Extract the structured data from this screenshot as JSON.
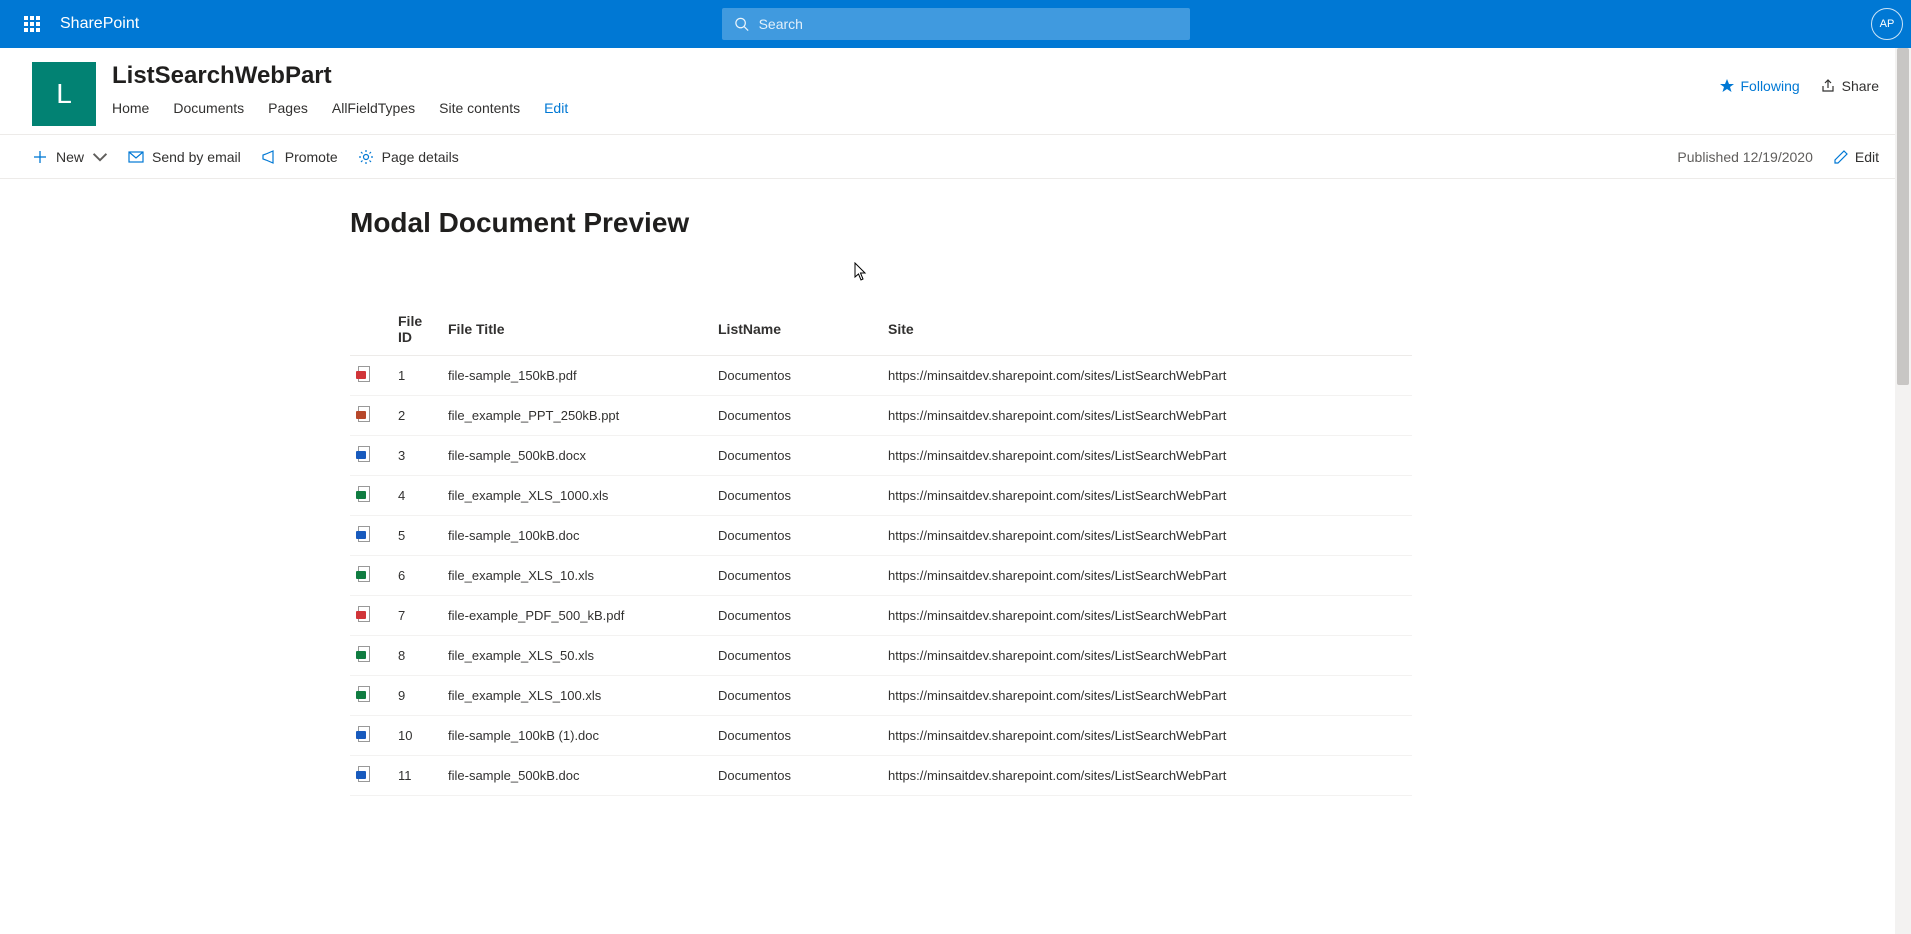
{
  "suite": {
    "brand": "SharePoint",
    "search_placeholder": "Search",
    "avatar_initials": "AP"
  },
  "site": {
    "logo_letter": "L",
    "title": "ListSearchWebPart",
    "nav": {
      "home": "Home",
      "documents": "Documents",
      "pages": "Pages",
      "allfieldtypes": "AllFieldTypes",
      "site_contents": "Site contents",
      "edit": "Edit"
    },
    "follow_label": "Following",
    "share_label": "Share"
  },
  "commandbar": {
    "new": "New",
    "send_by_email": "Send by email",
    "promote": "Promote",
    "page_details": "Page details",
    "published": "Published 12/19/2020",
    "edit": "Edit"
  },
  "page": {
    "title": "Modal Document Preview"
  },
  "table": {
    "headers": {
      "icon": "",
      "file_id": "File ID",
      "file_title": "File Title",
      "list_name": "ListName",
      "site": "Site"
    },
    "rows": [
      {
        "icon": "pdf",
        "id": "1",
        "title": "file-sample_150kB.pdf",
        "list": "Documentos",
        "site": "https://minsaitdev.sharepoint.com/sites/ListSearchWebPart"
      },
      {
        "icon": "ppt",
        "id": "2",
        "title": "file_example_PPT_250kB.ppt",
        "list": "Documentos",
        "site": "https://minsaitdev.sharepoint.com/sites/ListSearchWebPart"
      },
      {
        "icon": "doc",
        "id": "3",
        "title": "file-sample_500kB.docx",
        "list": "Documentos",
        "site": "https://minsaitdev.sharepoint.com/sites/ListSearchWebPart"
      },
      {
        "icon": "xls",
        "id": "4",
        "title": "file_example_XLS_1000.xls",
        "list": "Documentos",
        "site": "https://minsaitdev.sharepoint.com/sites/ListSearchWebPart"
      },
      {
        "icon": "doc",
        "id": "5",
        "title": "file-sample_100kB.doc",
        "list": "Documentos",
        "site": "https://minsaitdev.sharepoint.com/sites/ListSearchWebPart"
      },
      {
        "icon": "xls",
        "id": "6",
        "title": "file_example_XLS_10.xls",
        "list": "Documentos",
        "site": "https://minsaitdev.sharepoint.com/sites/ListSearchWebPart"
      },
      {
        "icon": "pdf",
        "id": "7",
        "title": "file-example_PDF_500_kB.pdf",
        "list": "Documentos",
        "site": "https://minsaitdev.sharepoint.com/sites/ListSearchWebPart"
      },
      {
        "icon": "xls",
        "id": "8",
        "title": "file_example_XLS_50.xls",
        "list": "Documentos",
        "site": "https://minsaitdev.sharepoint.com/sites/ListSearchWebPart"
      },
      {
        "icon": "xls",
        "id": "9",
        "title": "file_example_XLS_100.xls",
        "list": "Documentos",
        "site": "https://minsaitdev.sharepoint.com/sites/ListSearchWebPart"
      },
      {
        "icon": "doc",
        "id": "10",
        "title": "file-sample_100kB (1).doc",
        "list": "Documentos",
        "site": "https://minsaitdev.sharepoint.com/sites/ListSearchWebPart"
      },
      {
        "icon": "doc",
        "id": "11",
        "title": "file-sample_500kB.doc",
        "list": "Documentos",
        "site": "https://minsaitdev.sharepoint.com/sites/ListSearchWebPart"
      }
    ]
  }
}
